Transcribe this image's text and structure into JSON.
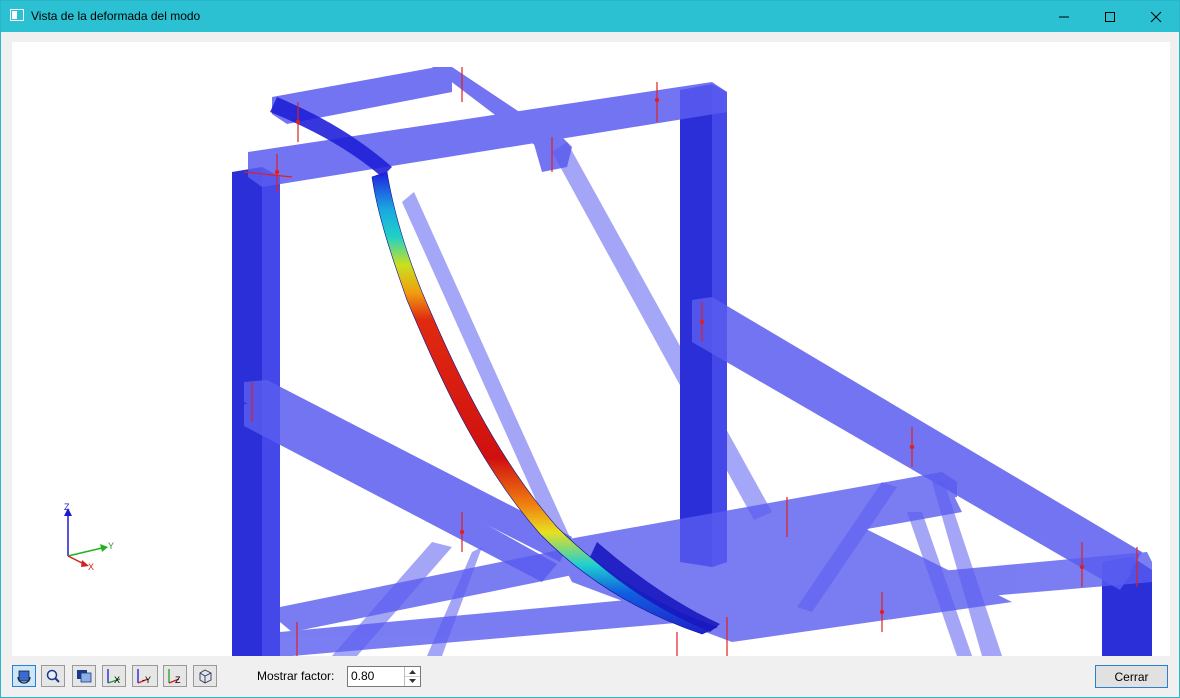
{
  "window": {
    "title": "Vista de la deformada del modo",
    "minimize_icon": "minimize-icon",
    "maximize_icon": "maximize-icon",
    "close_icon": "close-icon"
  },
  "viewport": {
    "axes": {
      "z": "Z",
      "y": "Y",
      "x": "X"
    },
    "colors": {
      "member": "#5a5cf0",
      "column": "#2a2fd8",
      "accent_red": "#e02020"
    }
  },
  "toolbar": {
    "buttons": [
      {
        "icon": "view-rotate-icon",
        "active": true
      },
      {
        "icon": "zoom-icon"
      },
      {
        "icon": "render-mode-icon"
      },
      {
        "icon": "view-x-icon",
        "label": "X"
      },
      {
        "icon": "view-minus-y-icon",
        "label": "-Y"
      },
      {
        "icon": "view-z-icon",
        "label": "Z"
      },
      {
        "icon": "isometric-view-icon"
      }
    ],
    "factor_label": "Mostrar factor:",
    "factor_value": "0.80",
    "close_label": "Cerrar"
  }
}
